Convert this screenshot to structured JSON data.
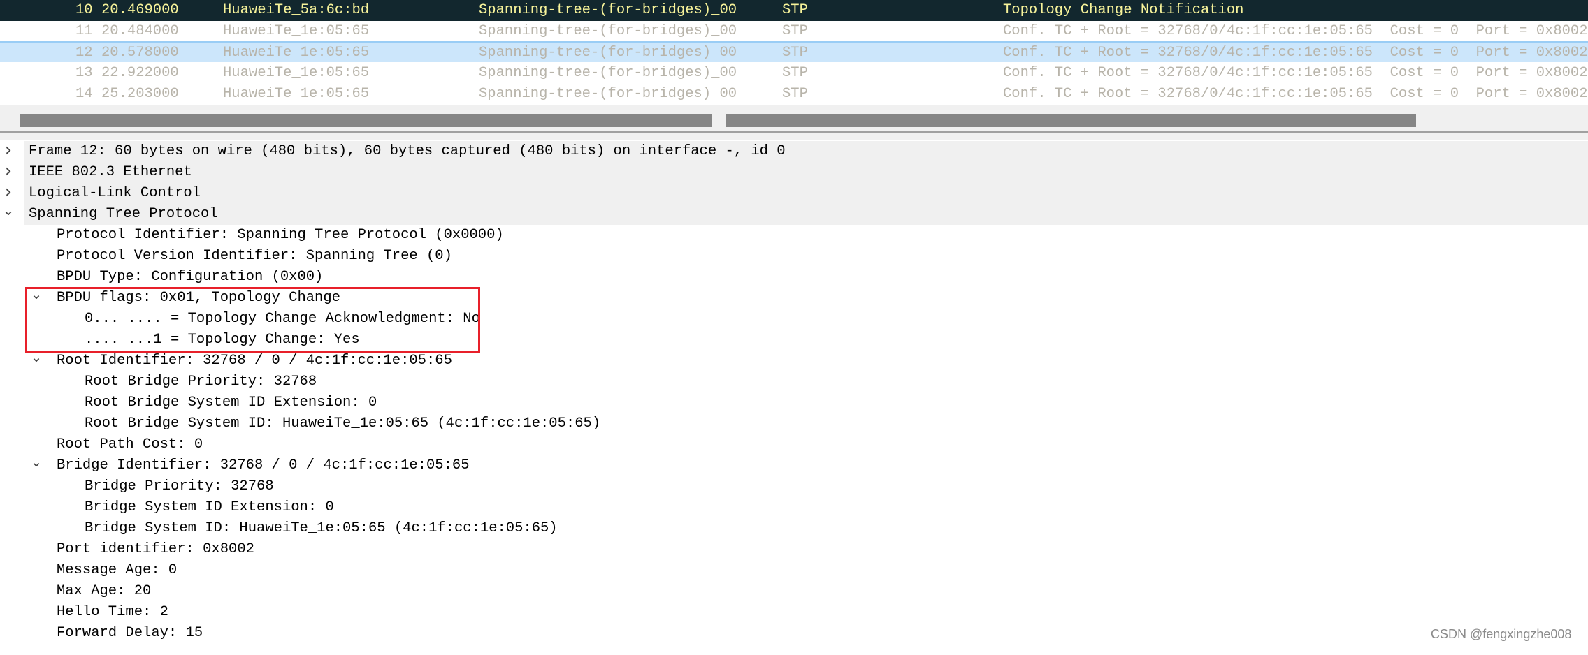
{
  "packet_list": {
    "rows": [
      {
        "no": "10",
        "time": "20.469000",
        "source": "HuaweiTe_5a:6c:bd",
        "destination": "Spanning-tree-(for-bridges)_00",
        "protocol": "STP",
        "info": "Topology Change Notification",
        "style": "dark"
      },
      {
        "no": "11",
        "time": "20.484000",
        "source": "HuaweiTe_1e:05:65",
        "destination": "Spanning-tree-(for-bridges)_00",
        "protocol": "STP",
        "info": "Conf. TC + Root = 32768/0/4c:1f:cc:1e:05:65  Cost = 0  Port = 0x8002",
        "style": "normal"
      },
      {
        "no": "12",
        "time": "20.578000",
        "source": "HuaweiTe_1e:05:65",
        "destination": "Spanning-tree-(for-bridges)_00",
        "protocol": "STP",
        "info": "Conf. TC + Root = 32768/0/4c:1f:cc:1e:05:65  Cost = 0  Port = 0x8002",
        "style": "selected"
      },
      {
        "no": "13",
        "time": "22.922000",
        "source": "HuaweiTe_1e:05:65",
        "destination": "Spanning-tree-(for-bridges)_00",
        "protocol": "STP",
        "info": "Conf. TC + Root = 32768/0/4c:1f:cc:1e:05:65  Cost = 0  Port = 0x8002",
        "style": "normal"
      },
      {
        "no": "14",
        "time": "25.203000",
        "source": "HuaweiTe_1e:05:65",
        "destination": "Spanning-tree-(for-bridges)_00",
        "protocol": "STP",
        "info": "Conf. TC + Root = 32768/0/4c:1f:cc:1e:05:65  Cost = 0  Port = 0x8002",
        "style": "normal"
      }
    ]
  },
  "details": [
    {
      "level": 0,
      "state": "collapsed",
      "text": "Frame 12: 60 bytes on wire (480 bits), 60 bytes captured (480 bits) on interface -, id 0"
    },
    {
      "level": 0,
      "state": "collapsed",
      "text": "IEEE 802.3 Ethernet"
    },
    {
      "level": 0,
      "state": "collapsed",
      "text": "Logical-Link Control"
    },
    {
      "level": 0,
      "state": "expanded",
      "text": "Spanning Tree Protocol"
    },
    {
      "level": 1,
      "state": "leaf",
      "text": "Protocol Identifier: Spanning Tree Protocol (0x0000)"
    },
    {
      "level": 1,
      "state": "leaf",
      "text": "Protocol Version Identifier: Spanning Tree (0)"
    },
    {
      "level": 1,
      "state": "leaf",
      "text": "BPDU Type: Configuration (0x00)"
    },
    {
      "level": 1,
      "state": "expanded",
      "text": "BPDU flags: 0x01, Topology Change"
    },
    {
      "level": 2,
      "state": "leaf",
      "text": "0... .... = Topology Change Acknowledgment: No"
    },
    {
      "level": 2,
      "state": "leaf",
      "text": ".... ...1 = Topology Change: Yes"
    },
    {
      "level": 1,
      "state": "expanded",
      "text": "Root Identifier: 32768 / 0 / 4c:1f:cc:1e:05:65"
    },
    {
      "level": 2,
      "state": "leaf",
      "text": "Root Bridge Priority: 32768"
    },
    {
      "level": 2,
      "state": "leaf",
      "text": "Root Bridge System ID Extension: 0"
    },
    {
      "level": 2,
      "state": "leaf",
      "text": "Root Bridge System ID: HuaweiTe_1e:05:65 (4c:1f:cc:1e:05:65)"
    },
    {
      "level": 1,
      "state": "leaf",
      "text": "Root Path Cost: 0"
    },
    {
      "level": 1,
      "state": "expanded",
      "text": "Bridge Identifier: 32768 / 0 / 4c:1f:cc:1e:05:65"
    },
    {
      "level": 2,
      "state": "leaf",
      "text": "Bridge Priority: 32768"
    },
    {
      "level": 2,
      "state": "leaf",
      "text": "Bridge System ID Extension: 0"
    },
    {
      "level": 2,
      "state": "leaf",
      "text": "Bridge System ID: HuaweiTe_1e:05:65 (4c:1f:cc:1e:05:65)"
    },
    {
      "level": 1,
      "state": "leaf",
      "text": "Port identifier: 0x8002"
    },
    {
      "level": 1,
      "state": "leaf",
      "text": "Message Age: 0"
    },
    {
      "level": 1,
      "state": "leaf",
      "text": "Max Age: 20"
    },
    {
      "level": 1,
      "state": "leaf",
      "text": "Hello Time: 2"
    },
    {
      "level": 1,
      "state": "leaf",
      "text": "Forward Delay: 15"
    }
  ],
  "highlight_color": "#e8202a",
  "watermark": "CSDN @fengxingzhe008"
}
